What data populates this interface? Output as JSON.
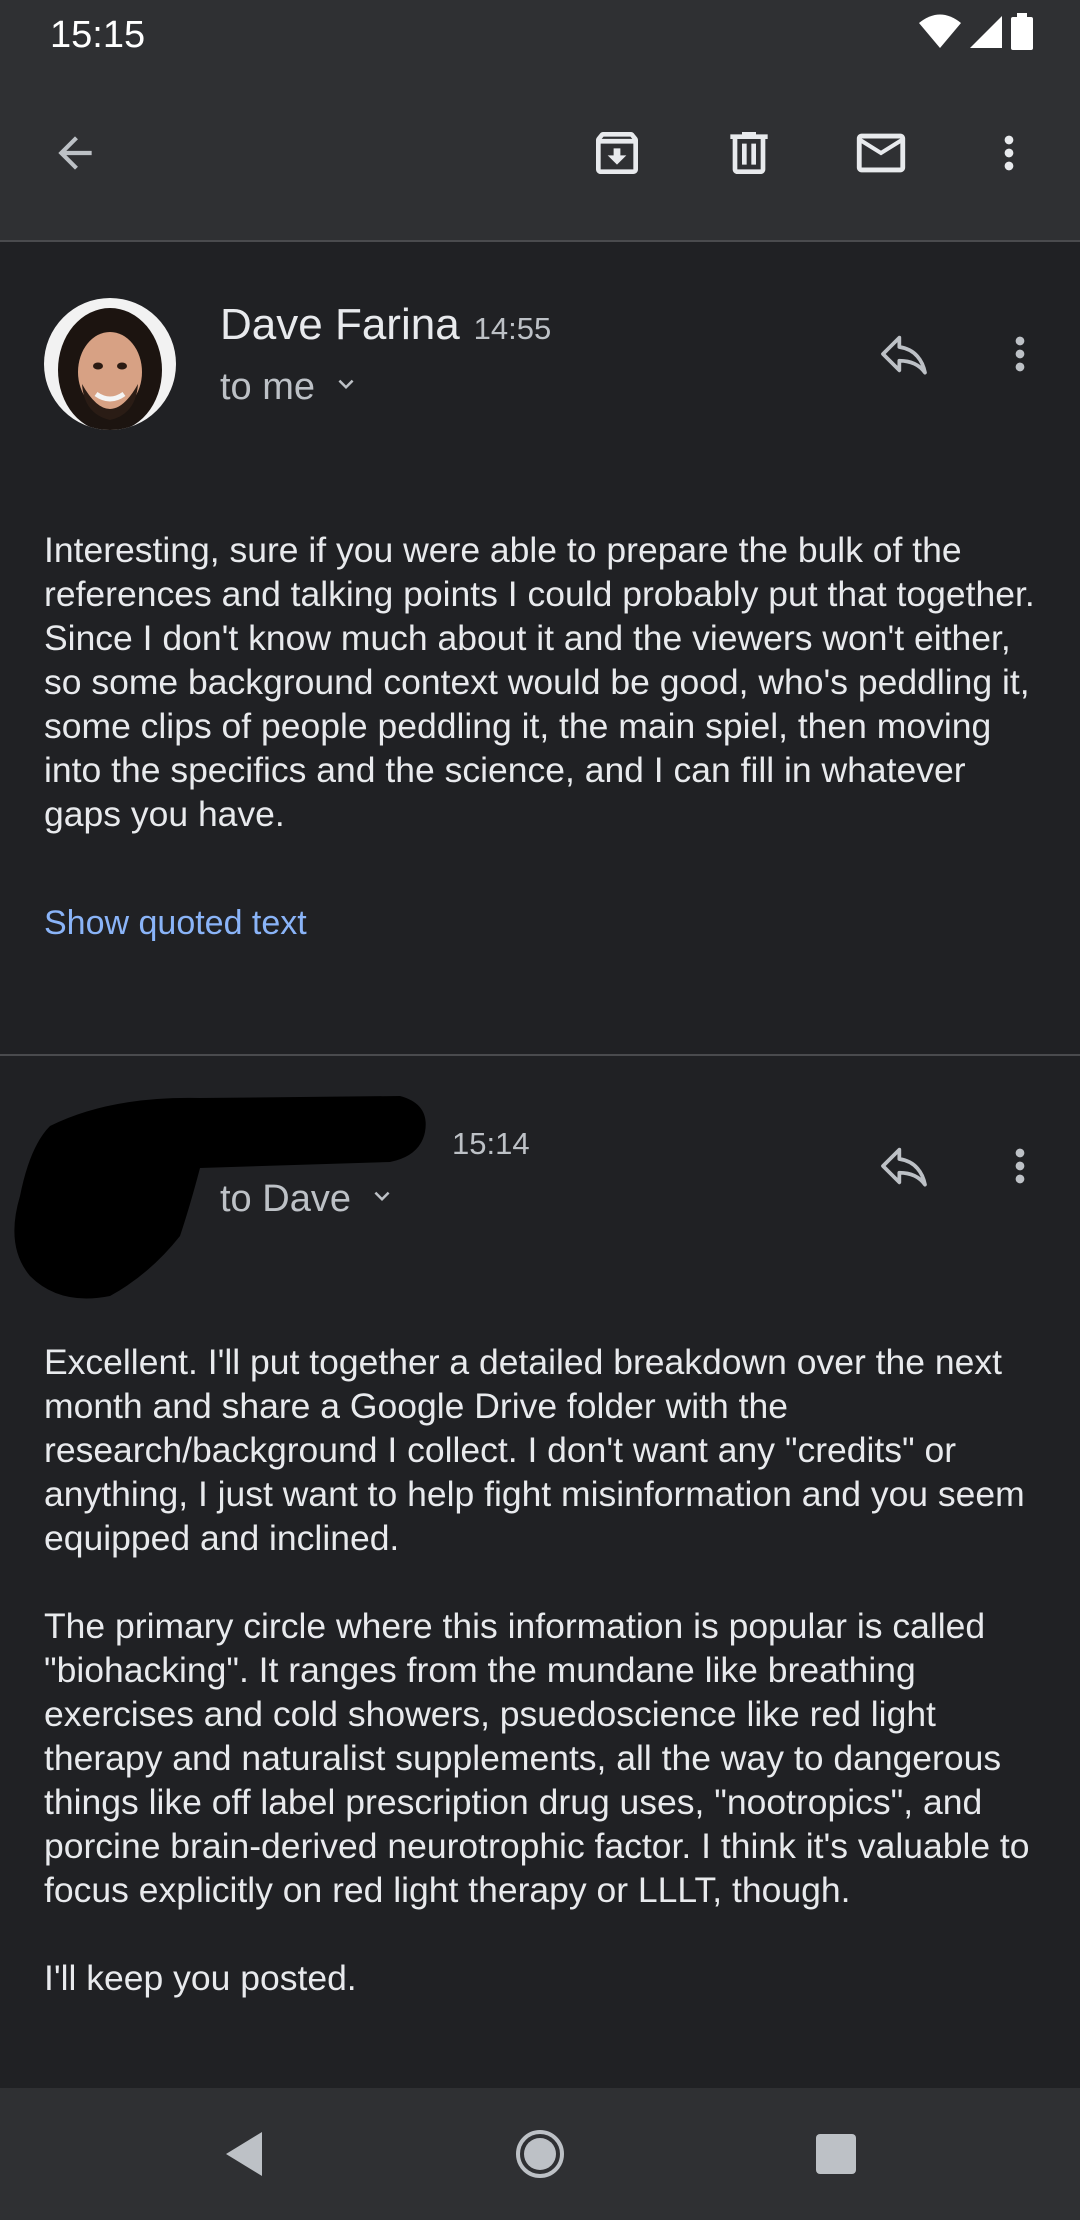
{
  "status_bar": {
    "time": "15:15",
    "icons": [
      "wifi-icon",
      "cell-signal-icon",
      "battery-icon"
    ]
  },
  "toolbar": {
    "icons": [
      "back-arrow-icon",
      "archive-icon",
      "delete-icon",
      "mark-unread-icon",
      "more-vert-icon"
    ]
  },
  "messages": [
    {
      "sender": "Dave Farina",
      "time": "14:55",
      "recipient": "to me",
      "paragraphs": [
        "Interesting, sure if you were able to prepare the bulk of the references and talking points I could probably put that together. Since I don't know much about it and the viewers won't either, so some background context would be good, who's peddling it, some clips of people peddling it, the main spiel, then moving into the specifics and the science, and I can fill in whatever gaps you have."
      ],
      "show_quoted": "Show quoted text"
    },
    {
      "sender": "",
      "time": "15:14",
      "recipient": "to Dave",
      "paragraphs": [
        "Excellent. I'll put together a detailed breakdown over the next month and share a Google Drive folder with the research/background I collect. I don't want any \"credits\" or anything, I just want to help fight misinformation and you seem equipped and inclined.",
        "The primary circle where this information is popular is called \"biohacking\". It ranges from the mundane like breathing exercises and cold showers, psuedoscience like red light therapy and naturalist supplements, all the way to dangerous things like off label prescription drug uses, \"nootropics\", and porcine brain-derived neurotrophic factor. I think it's valuable to focus explicitly on red light therapy or LLLT, though.",
        "I'll keep you posted."
      ]
    }
  ],
  "nav_bar": {
    "icons": [
      "back-triangle-icon",
      "home-circle-icon",
      "recents-square-icon"
    ]
  },
  "colors": {
    "background": "#202124",
    "bar": "#2f3033",
    "text": "#e8eaed",
    "secondary_text": "#bdc1c6",
    "link": "#8ab4f8"
  }
}
